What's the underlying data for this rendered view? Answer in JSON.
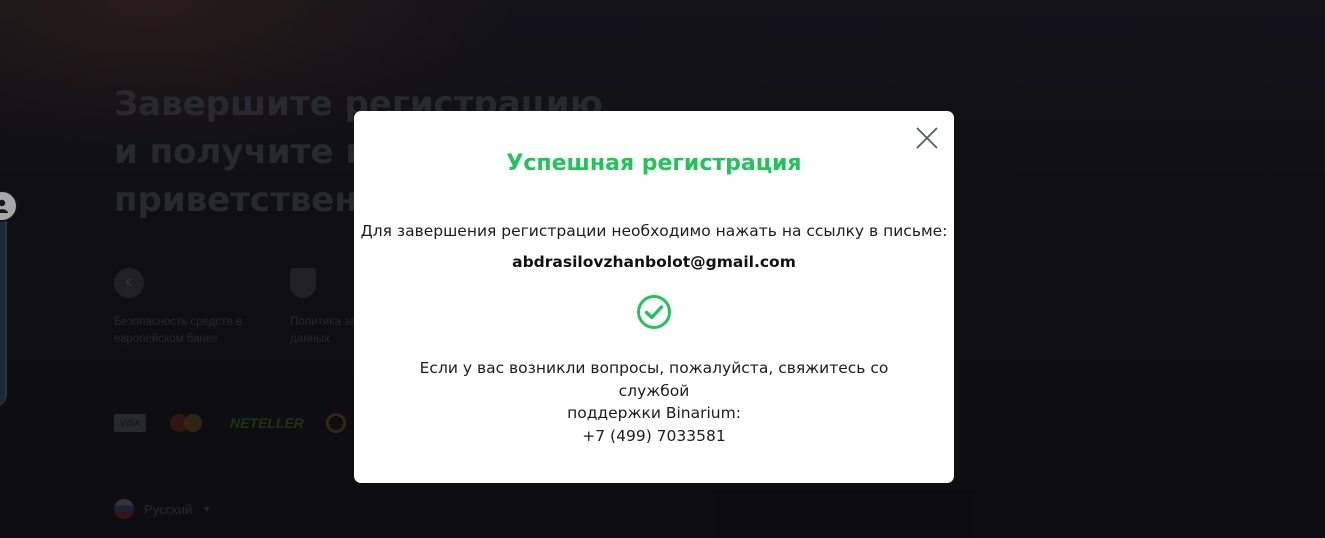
{
  "background": {
    "headline_lines": [
      "Завершите регистрацию",
      "и получите п",
      "приветствен"
    ],
    "features": [
      {
        "icon": "euro-coin-icon",
        "text": "Безопасность средств в европейском банке"
      },
      {
        "icon": "shield-icon",
        "text": "Политика защиты личных данных"
      }
    ],
    "payments": [
      "VISA",
      "mastercard",
      "NETELLER",
      "qiwi"
    ],
    "language": "Русский"
  },
  "modal": {
    "title": "Успешная регистрация",
    "message": "Для завершения регистрации необходимо нажать на ссылку в письме:",
    "email": "abdrasilovzhanbolot@gmail.com",
    "status_icon": "check-circle-icon",
    "support_line1": "Если у вас возникли вопросы, пожалуйста, свяжитесь со службой",
    "support_line2": "поддержки Binarium:",
    "phone": "+7 (499) 7033581",
    "close_icon": "close-icon"
  },
  "colors": {
    "success": "#23c35a",
    "modal_bg": "#ffffff",
    "page_bg": "#15151b"
  }
}
